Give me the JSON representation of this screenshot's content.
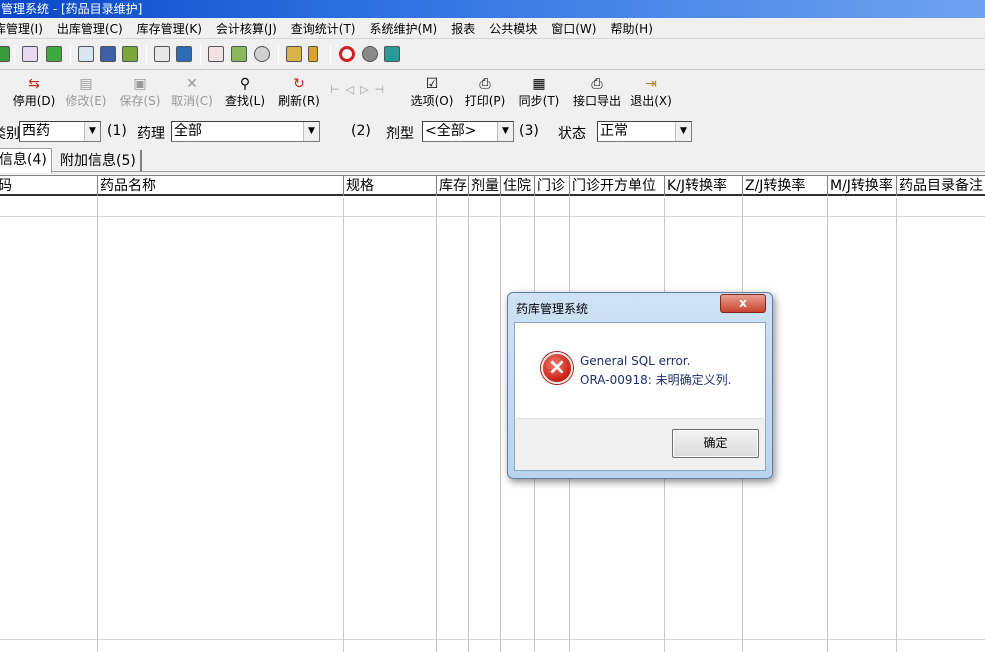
{
  "window": {
    "title": "管理系统 - [药品目录维护]"
  },
  "menu": [
    "库管理(I)",
    "出库管理(C)",
    "库存管理(K)",
    "会计核算(J)",
    "查询统计(T)",
    "系统维护(M)",
    "报表",
    "公共模块",
    "窗口(W)",
    "帮助(H)"
  ],
  "toolbar": {
    "disable": "停用(D)",
    "edit": "修改(E)",
    "save": "保存(S)",
    "cancel": "取消(C)",
    "find": "查找(L)",
    "refresh": "刷新(R)",
    "options": "选项(O)",
    "print": "打印(P)",
    "sync": "同步(T)",
    "export": "接口导出",
    "exit": "退出(X)"
  },
  "filters": {
    "category_label": "类别",
    "category_value": "西药",
    "hint1": "(1)",
    "pharmacology_label": "药理",
    "pharmacology_value": "全部",
    "hint2": "(2)",
    "dosage_label": "剂型",
    "dosage_value": "<全部>",
    "hint3": "(3)",
    "status_label": "状态",
    "status_value": "正常"
  },
  "tabs": [
    "信息(4)",
    "附加信息(5)"
  ],
  "grid": {
    "columns": [
      "码",
      "药品名称",
      "规格",
      "库存",
      "剂量",
      "住院",
      "门诊",
      "门诊开方单位",
      "K/J转换率",
      "Z/J转换率",
      "M/J转换率",
      "药品目录备注"
    ]
  },
  "dialog": {
    "title": "药库管理系统",
    "close_label": "x",
    "line1": "General SQL error.",
    "line2": "ORA-00918: 未明确定义列.",
    "ok_label": "确定"
  },
  "colors": {
    "titlebar": "#0b47c8",
    "error_icon": "#c81e14"
  }
}
